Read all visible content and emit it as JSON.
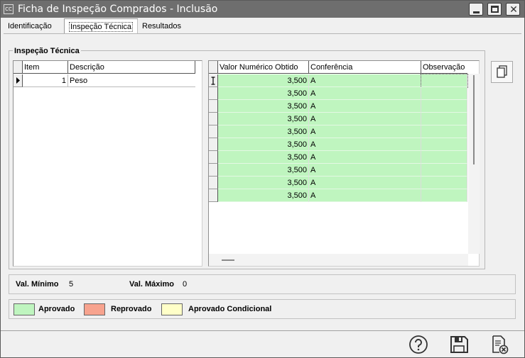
{
  "window": {
    "app_icon": "CC",
    "title": "Ficha de Inspeção Comprados - Inclusão"
  },
  "tabs": [
    {
      "label": "Identificação"
    },
    {
      "label": "Inspeção Técnica",
      "active": true
    },
    {
      "label": "Resultados"
    }
  ],
  "section": {
    "title": "Inspeção Técnica"
  },
  "items_grid": {
    "columns": [
      "Item",
      "Descrição"
    ],
    "rows": [
      {
        "item": "1",
        "descricao": "Peso"
      }
    ]
  },
  "results_grid": {
    "columns": [
      "Valor Numérico Obtido",
      "Conferência",
      "Observação"
    ],
    "row_color": "#bff5bf",
    "rows": [
      {
        "valor": "3,500",
        "conferencia": "A",
        "observacao": ""
      },
      {
        "valor": "3,500",
        "conferencia": "A",
        "observacao": ""
      },
      {
        "valor": "3,500",
        "conferencia": "A",
        "observacao": ""
      },
      {
        "valor": "3,500",
        "conferencia": "A",
        "observacao": ""
      },
      {
        "valor": "3,500",
        "conferencia": "A",
        "observacao": ""
      },
      {
        "valor": "3,500",
        "conferencia": "A",
        "observacao": ""
      },
      {
        "valor": "3,500",
        "conferencia": "A",
        "observacao": ""
      },
      {
        "valor": "3,500",
        "conferencia": "A",
        "observacao": ""
      },
      {
        "valor": "3,500",
        "conferencia": "A",
        "observacao": ""
      },
      {
        "valor": "3,500",
        "conferencia": "A",
        "observacao": ""
      }
    ]
  },
  "limits": {
    "min_label": "Val. Mínimo",
    "min_value": "5",
    "max_label": "Val. Máximo",
    "max_value": "0"
  },
  "legend": [
    {
      "label": "Aprovado",
      "color": "#bff5bf"
    },
    {
      "label": "Reprovado",
      "color": "#f7a38e"
    },
    {
      "label": "Aprovado Condicional",
      "color": "#ffffc8"
    }
  ],
  "icons": {
    "copy": "copy-icon",
    "help": "help-icon",
    "save": "save-icon",
    "cancel": "cancel-document-icon"
  }
}
